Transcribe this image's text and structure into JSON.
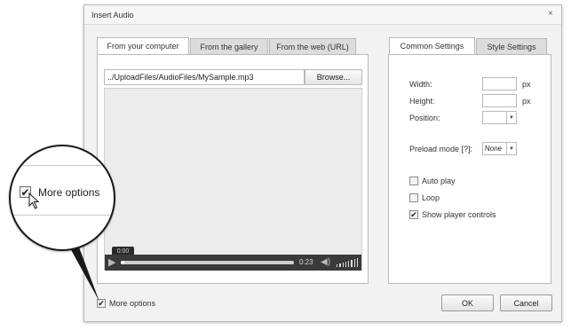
{
  "dialog": {
    "title": "Insert Audio",
    "close_glyph": "×"
  },
  "left_tabs": [
    "From your computer",
    "From the gallery",
    "From the web (URL)"
  ],
  "file_path": "../UploadFiles/AudioFiles/MySample.mp3",
  "browse_label": "Browse...",
  "player": {
    "tooltip_time": "0:00",
    "current_time": "0:23",
    "progress_fraction": 0.02
  },
  "right_tabs": [
    "Common Settings",
    "Style Settings"
  ],
  "settings": {
    "width_label": "Width:",
    "width_value": "",
    "width_unit": "px",
    "height_label": "Height:",
    "height_value": "",
    "height_unit": "px",
    "position_label": "Position:",
    "position_value": "",
    "preload_label": "Preload mode [?]:",
    "preload_value": "None",
    "autoplay_label": "Auto play",
    "autoplay_checked": false,
    "loop_label": "Loop",
    "loop_checked": false,
    "controls_label": "Show player controls",
    "controls_checked": true
  },
  "more_options_label": "More options",
  "more_options_checked": true,
  "ok_label": "OK",
  "cancel_label": "Cancel",
  "colors": {
    "player_bg": "#ececec",
    "player_bar": "#3a3a3a",
    "accent_border": "#b9b9b9"
  }
}
